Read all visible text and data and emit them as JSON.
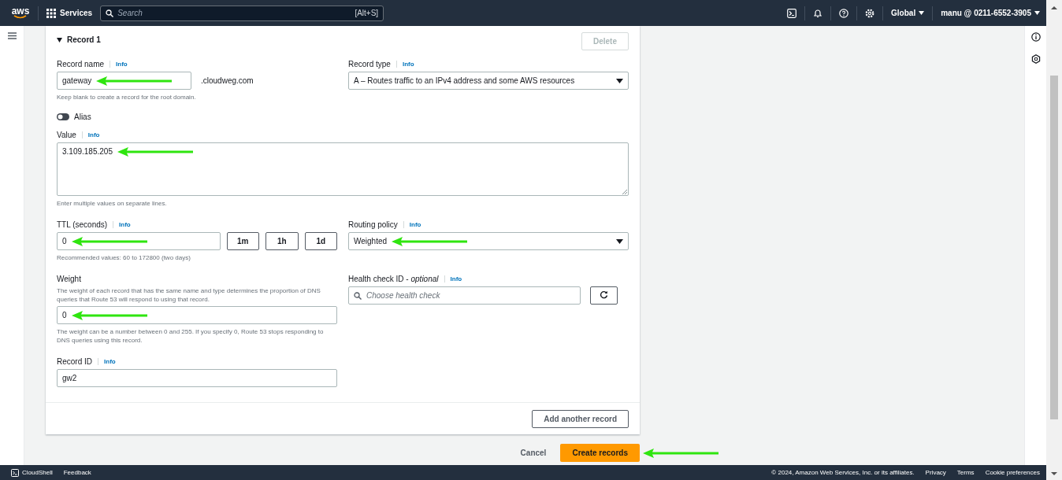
{
  "top_nav": {
    "logo": "aws",
    "services": "Services",
    "search": {
      "placeholder": "Search",
      "shortcut": "[Alt+S]"
    },
    "region": "Global",
    "account": "manu @ 0211-6552-3905"
  },
  "record": {
    "title": "Record 1",
    "expanded": true,
    "delete": {
      "label": "Delete",
      "disabled": true
    },
    "record_name": {
      "label": "Record name",
      "info": "Info",
      "value": "gateway",
      "suffix": ".cloudweg.com",
      "hint": "Keep blank to create a record for the root domain.",
      "arrow": true
    },
    "record_type": {
      "label": "Record type",
      "info": "Info",
      "value": "A – Routes traffic to an IPv4 address and some AWS resources"
    },
    "alias": {
      "label": "Alias",
      "on": false
    },
    "value": {
      "label": "Value",
      "info": "Info",
      "value": "3.109.185.205",
      "hint": "Enter multiple values on separate lines.",
      "arrow": true
    },
    "ttl": {
      "label": "TTL (seconds)",
      "info": "Info",
      "value": "0",
      "presets": [
        "1m",
        "1h",
        "1d"
      ],
      "hint": "Recommended values: 60 to 172800 (two days)",
      "arrow": true
    },
    "routing_policy": {
      "label": "Routing policy",
      "info": "Info",
      "value": "Weighted",
      "arrow": true
    },
    "weight": {
      "label": "Weight",
      "description": "The weight of each record that has the same name and type determines the proportion of DNS queries that Route 53 will respond to using that record.",
      "value": "0",
      "hint": "The weight can be a number between 0 and 255. If you specify 0, Route 53 stops responding to DNS queries using this record.",
      "arrow": true
    },
    "health_check": {
      "label": "Health check ID - *optional*",
      "info": "Info",
      "placeholder": "Choose health check"
    },
    "record_id": {
      "label": "Record ID",
      "info": "Info",
      "value": "gw2"
    },
    "add_button": "Add another record"
  },
  "actions": {
    "cancel": "Cancel",
    "create": {
      "label": "Create records",
      "arrow": true
    }
  },
  "footer": {
    "cloudshell": "CloudShell",
    "feedback": "Feedback",
    "copyright": "© 2024, Amazon Web Services, Inc. or its affiliates.",
    "links": [
      "Privacy",
      "Terms",
      "Cookie preferences"
    ]
  }
}
